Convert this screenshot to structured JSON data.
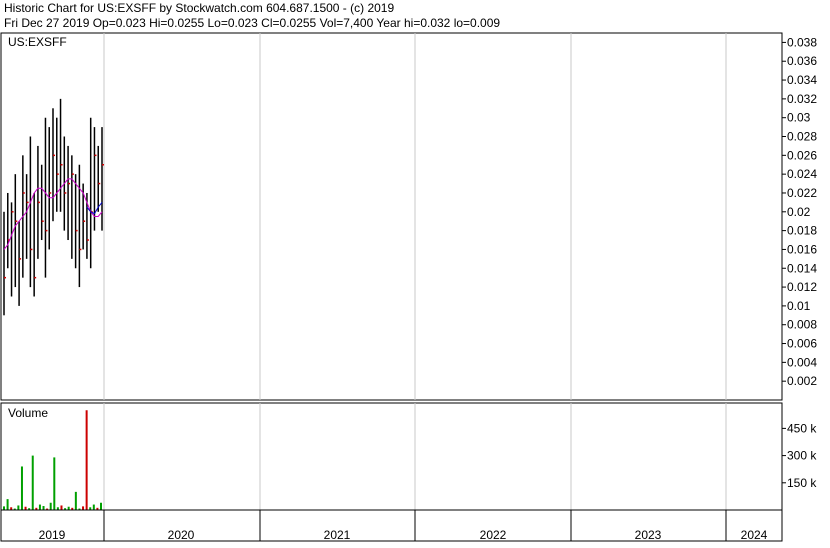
{
  "header": {
    "line1": "Historic Chart for US:EXSFF by Stockwatch.com 604.687.1500 - (c) 2019",
    "line2": "Fri Dec 27 2019   Op=0.023   Hi=0.0255   Lo=0.023   Cl=0.0255   Vol=7,400   Year hi=0.032   lo=0.009"
  },
  "colors": {
    "background": "#ffffff",
    "grid": "#c8c8c8",
    "axis": "#000000",
    "price_bar": "#000000",
    "close_tick": "#cc0000",
    "moving_avg_1": "#cc00cc",
    "moving_avg_2": "#0000cc",
    "volume_up": "#00a000",
    "volume_down": "#cc0000"
  },
  "chart_data": [
    {
      "type": "ohlc",
      "title": "US:EXSFF",
      "ylim": [
        0,
        0.039
      ],
      "y_ticks": [
        "0.038",
        "0.036",
        "0.034",
        "0.032",
        "0.03",
        "0.028",
        "0.026",
        "0.024",
        "0.022",
        "0.02",
        "0.018",
        "0.016",
        "0.014",
        "0.012",
        "0.01",
        "0.008",
        "0.006",
        "0.004",
        "0.002"
      ],
      "x_ticks": [
        "2019",
        "2020",
        "2021",
        "2022",
        "2023",
        "2024"
      ],
      "series": [
        {
          "type": "bars",
          "points": [
            {
              "hi": 0.02,
              "lo": 0.009,
              "cl": 0.013
            },
            {
              "hi": 0.022,
              "lo": 0.014,
              "cl": 0.017
            },
            {
              "hi": 0.021,
              "lo": 0.011,
              "cl": 0.02
            },
            {
              "hi": 0.024,
              "lo": 0.012,
              "cl": 0.019
            },
            {
              "hi": 0.019,
              "lo": 0.01,
              "cl": 0.015
            },
            {
              "hi": 0.026,
              "lo": 0.013,
              "cl": 0.022
            },
            {
              "hi": 0.024,
              "lo": 0.015,
              "cl": 0.021
            },
            {
              "hi": 0.028,
              "lo": 0.012,
              "cl": 0.016
            },
            {
              "hi": 0.022,
              "lo": 0.011,
              "cl": 0.013
            },
            {
              "hi": 0.027,
              "lo": 0.015,
              "cl": 0.021
            },
            {
              "hi": 0.025,
              "lo": 0.017,
              "cl": 0.019
            },
            {
              "hi": 0.03,
              "lo": 0.013,
              "cl": 0.018
            },
            {
              "hi": 0.029,
              "lo": 0.016,
              "cl": 0.022
            },
            {
              "hi": 0.031,
              "lo": 0.019,
              "cl": 0.026
            },
            {
              "hi": 0.03,
              "lo": 0.02,
              "cl": 0.024
            },
            {
              "hi": 0.032,
              "lo": 0.02,
              "cl": 0.025
            },
            {
              "hi": 0.028,
              "lo": 0.018,
              "cl": 0.022
            },
            {
              "hi": 0.027,
              "lo": 0.017,
              "cl": 0.023
            },
            {
              "hi": 0.026,
              "lo": 0.015,
              "cl": 0.024
            },
            {
              "hi": 0.024,
              "lo": 0.014,
              "cl": 0.018
            },
            {
              "hi": 0.025,
              "lo": 0.012,
              "cl": 0.016
            },
            {
              "hi": 0.023,
              "lo": 0.016,
              "cl": 0.019
            },
            {
              "hi": 0.022,
              "lo": 0.015,
              "cl": 0.017
            },
            {
              "hi": 0.03,
              "lo": 0.014,
              "cl": 0.02
            },
            {
              "hi": 0.029,
              "lo": 0.018,
              "cl": 0.026
            },
            {
              "hi": 0.027,
              "lo": 0.02,
              "cl": 0.023
            },
            {
              "hi": 0.029,
              "lo": 0.018,
              "cl": 0.025
            }
          ]
        },
        {
          "type": "moving_average",
          "values": [
            0.016,
            0.0165,
            0.0175,
            0.0185,
            0.019,
            0.0195,
            0.02,
            0.021,
            0.022,
            0.0225,
            0.0225,
            0.022,
            0.0215,
            0.0215,
            0.022,
            0.0225,
            0.023,
            0.0235,
            0.0235,
            0.023,
            0.0225,
            0.022,
            0.021,
            0.02,
            0.0195,
            0.0195,
            0.02
          ]
        },
        {
          "type": "moving_average",
          "values": [
            null,
            null,
            null,
            null,
            null,
            null,
            null,
            null,
            null,
            null,
            null,
            null,
            null,
            null,
            null,
            null,
            null,
            null,
            null,
            null,
            null,
            null,
            0.0205,
            0.02,
            0.0198,
            0.0205,
            0.021
          ]
        }
      ]
    },
    {
      "type": "bar",
      "title": "Volume",
      "ylim": [
        0,
        590000
      ],
      "y_ticks": [
        "450 k",
        "300 k",
        "150 k"
      ],
      "y_tick_values": [
        450000,
        300000,
        150000
      ],
      "values": [
        {
          "v": 20000,
          "up": true
        },
        {
          "v": 60000,
          "up": true
        },
        {
          "v": 15000,
          "up": false
        },
        {
          "v": 8000,
          "up": true
        },
        {
          "v": 25000,
          "up": true
        },
        {
          "v": 240000,
          "up": true
        },
        {
          "v": 18000,
          "up": false
        },
        {
          "v": 10000,
          "up": true
        },
        {
          "v": 300000,
          "up": true
        },
        {
          "v": 12000,
          "up": false
        },
        {
          "v": 30000,
          "up": true
        },
        {
          "v": 22000,
          "up": true
        },
        {
          "v": 8000,
          "up": false
        },
        {
          "v": 40000,
          "up": true
        },
        {
          "v": 290000,
          "up": true
        },
        {
          "v": 15000,
          "up": true
        },
        {
          "v": 25000,
          "up": false
        },
        {
          "v": 10000,
          "up": true
        },
        {
          "v": 18000,
          "up": true
        },
        {
          "v": 12000,
          "up": false
        },
        {
          "v": 100000,
          "up": true
        },
        {
          "v": 8000,
          "up": true
        },
        {
          "v": 20000,
          "up": false
        },
        {
          "v": 550000,
          "up": false
        },
        {
          "v": 15000,
          "up": true
        },
        {
          "v": 30000,
          "up": true
        },
        {
          "v": 12000,
          "up": false
        },
        {
          "v": 40000,
          "up": true
        }
      ]
    }
  ]
}
